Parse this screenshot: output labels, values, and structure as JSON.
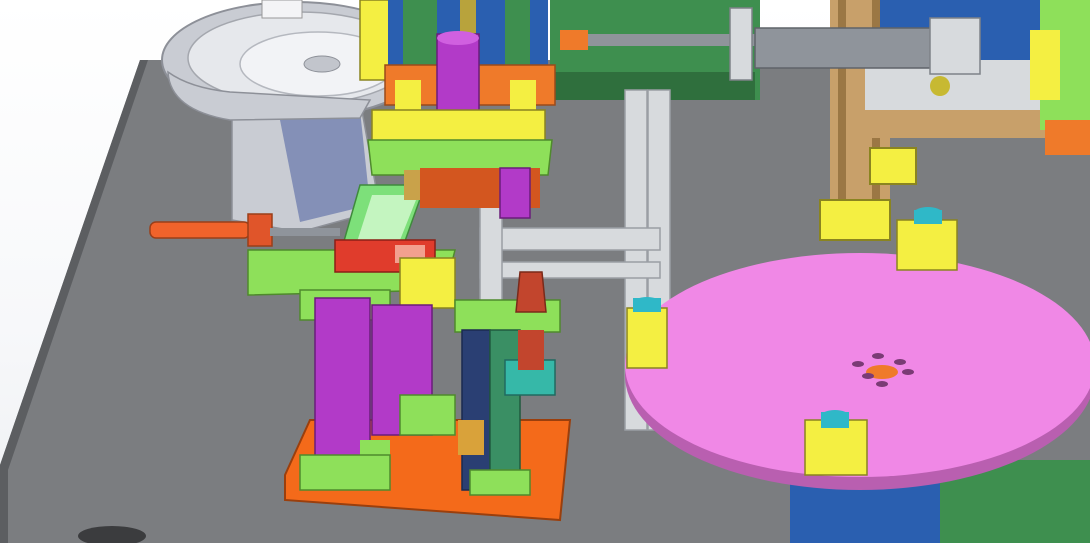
{
  "viewport": {
    "label": ""
  },
  "colors": {
    "table": "#7b7d80",
    "table_edge": "#5c5e61",
    "rotary_plate": "#f088e6",
    "rotary_edge": "#b95fb0",
    "base_plate": "#f46a1a",
    "rail_purple": "#b23ac8",
    "bracket_yellow": "#f4ef42",
    "bracket_green": "#8ee05a",
    "frame_silver": "#d7dadd",
    "frame_tan": "#c8a06a",
    "motor_green": "#3e8f4f",
    "nut_cyan": "#2fb8c8",
    "bowl_metal": "#c9ccd3",
    "cylinder_grey": "#8f949b",
    "block_red": "#e03c2c",
    "block_blue": "#2a5fb0",
    "cup_red": "#c2452d",
    "pin_cyan": "#38c6c8"
  },
  "parts": [
    "vibratory-bowl-feeder",
    "linear-feeder-track",
    "pick-and-place-cylinder",
    "transfer-slide-cylinder",
    "rotary-index-table",
    "fixture-seats",
    "lift-cylinder-stand",
    "gripper-station",
    "machine-frame",
    "drive-motor"
  ]
}
